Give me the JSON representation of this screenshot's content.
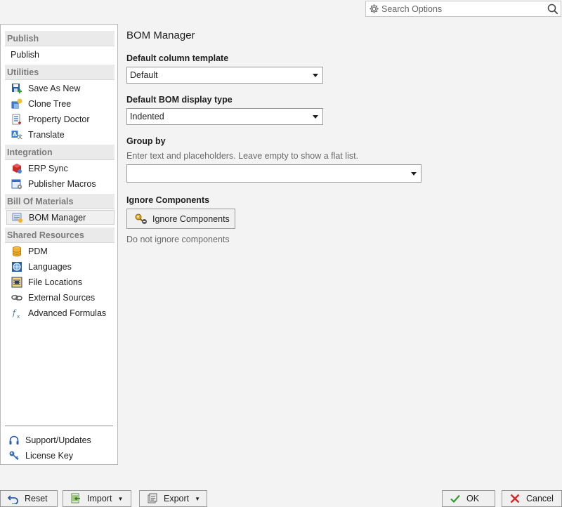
{
  "search": {
    "placeholder": "Search Options"
  },
  "sidebar": {
    "sections": [
      {
        "header": "Publish",
        "items": [
          {
            "label": "Publish",
            "icon": "none"
          }
        ]
      },
      {
        "header": "Utilities",
        "items": [
          {
            "label": "Save As New",
            "icon": "save-as-new-icon"
          },
          {
            "label": "Clone Tree",
            "icon": "clone-tree-icon"
          },
          {
            "label": "Property Doctor",
            "icon": "property-doctor-icon"
          },
          {
            "label": "Translate",
            "icon": "translate-icon"
          }
        ]
      },
      {
        "header": "Integration",
        "items": [
          {
            "label": "ERP Sync",
            "icon": "erp-sync-icon"
          },
          {
            "label": "Publisher Macros",
            "icon": "publisher-macros-icon"
          }
        ]
      },
      {
        "header": "Bill Of Materials",
        "items": [
          {
            "label": "BOM Manager",
            "icon": "bom-manager-icon",
            "selected": true
          }
        ]
      },
      {
        "header": "Shared Resources",
        "items": [
          {
            "label": "PDM",
            "icon": "pdm-icon"
          },
          {
            "label": "Languages",
            "icon": "languages-icon"
          },
          {
            "label": "File Locations",
            "icon": "file-locations-icon"
          },
          {
            "label": "External Sources",
            "icon": "link-icon"
          },
          {
            "label": "Advanced Formulas",
            "icon": "formula-icon"
          }
        ]
      }
    ],
    "bottom": [
      {
        "label": "Support/Updates",
        "icon": "headset-icon"
      },
      {
        "label": "License Key",
        "icon": "key-icon"
      }
    ]
  },
  "main": {
    "title": "BOM Manager",
    "column_template": {
      "label": "Default column template",
      "value": "Default"
    },
    "display_type": {
      "label": "Default BOM display type",
      "value": "Indented"
    },
    "group_by": {
      "label": "Group by",
      "hint": "Enter text and placeholders. Leave empty to show a flat list.",
      "value": ""
    },
    "ignore": {
      "label": "Ignore Components",
      "button": "Ignore Components",
      "status": "Do not ignore components"
    }
  },
  "footer": {
    "reset": "Reset",
    "import": "Import",
    "export": "Export",
    "ok": "OK",
    "cancel": "Cancel"
  },
  "colors": {
    "ok_check": "#2f9e2f",
    "cancel_x": "#d42a2a",
    "selected_bg": "#f0f0f0"
  }
}
